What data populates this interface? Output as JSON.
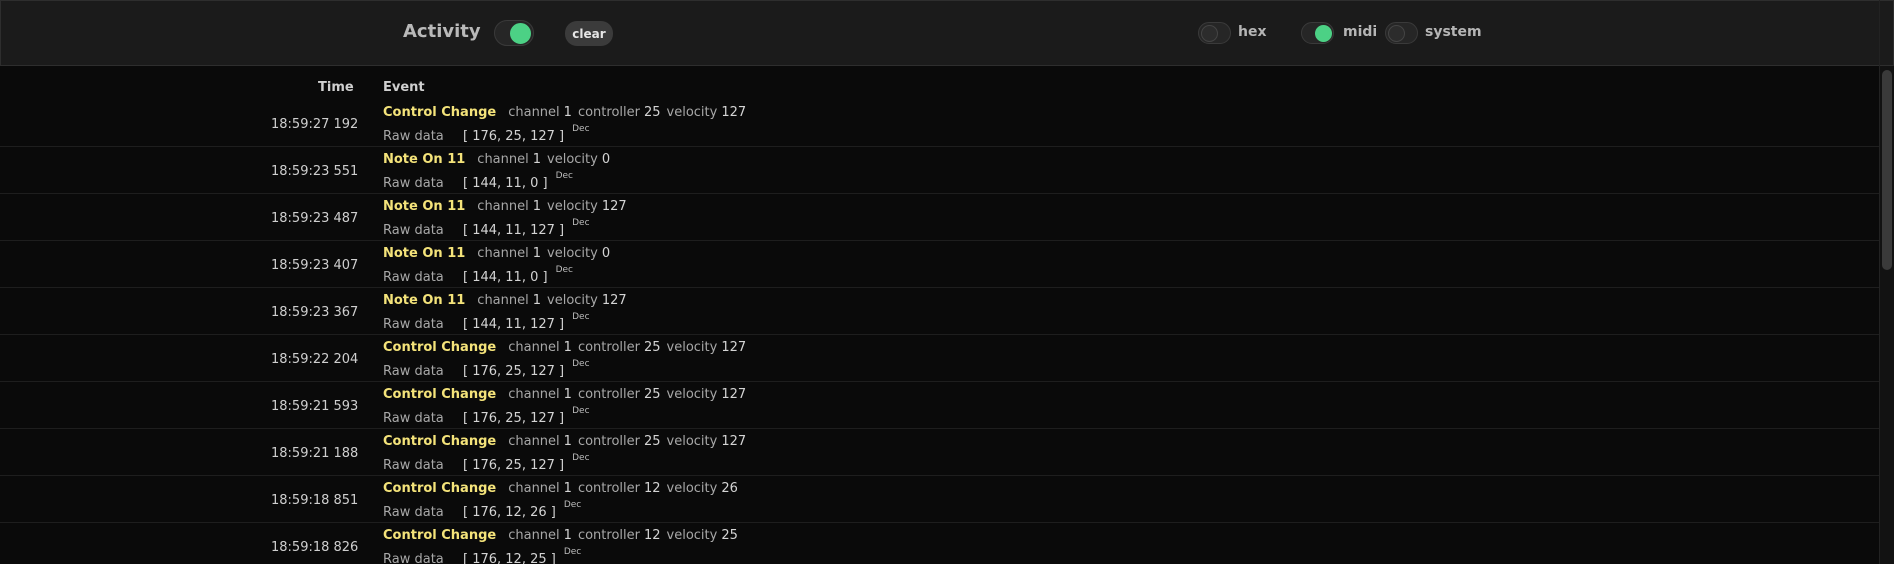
{
  "header": {
    "title": "Activity",
    "clear_label": "clear",
    "options": [
      {
        "label": "hex",
        "on": false
      },
      {
        "label": "midi",
        "on": true
      },
      {
        "label": "system",
        "on": false
      }
    ],
    "activity_on": true,
    "accent": "#4cd185"
  },
  "table": {
    "col_time": "Time",
    "col_event": "Event",
    "raw_label": "Raw data",
    "dec_label": "Dec",
    "event_color": "#f4e37a",
    "rows": [
      {
        "time": "18:59:27 192",
        "event": "Control Change",
        "attrs": [
          [
            "channel",
            "1"
          ],
          [
            "controller",
            "25"
          ],
          [
            "velocity",
            "127"
          ]
        ],
        "raw": "[ 176, 25, 127 ]"
      },
      {
        "time": "18:59:23 551",
        "event": "Note On 11",
        "attrs": [
          [
            "channel",
            "1"
          ],
          [
            "velocity",
            "0"
          ]
        ],
        "raw": "[ 144, 11, 0 ]"
      },
      {
        "time": "18:59:23 487",
        "event": "Note On 11",
        "attrs": [
          [
            "channel",
            "1"
          ],
          [
            "velocity",
            "127"
          ]
        ],
        "raw": "[ 144, 11, 127 ]"
      },
      {
        "time": "18:59:23 407",
        "event": "Note On 11",
        "attrs": [
          [
            "channel",
            "1"
          ],
          [
            "velocity",
            "0"
          ]
        ],
        "raw": "[ 144, 11, 0 ]"
      },
      {
        "time": "18:59:23 367",
        "event": "Note On 11",
        "attrs": [
          [
            "channel",
            "1"
          ],
          [
            "velocity",
            "127"
          ]
        ],
        "raw": "[ 144, 11, 127 ]"
      },
      {
        "time": "18:59:22 204",
        "event": "Control Change",
        "attrs": [
          [
            "channel",
            "1"
          ],
          [
            "controller",
            "25"
          ],
          [
            "velocity",
            "127"
          ]
        ],
        "raw": "[ 176, 25, 127 ]"
      },
      {
        "time": "18:59:21 593",
        "event": "Control Change",
        "attrs": [
          [
            "channel",
            "1"
          ],
          [
            "controller",
            "25"
          ],
          [
            "velocity",
            "127"
          ]
        ],
        "raw": "[ 176, 25, 127 ]"
      },
      {
        "time": "18:59:21 188",
        "event": "Control Change",
        "attrs": [
          [
            "channel",
            "1"
          ],
          [
            "controller",
            "25"
          ],
          [
            "velocity",
            "127"
          ]
        ],
        "raw": "[ 176, 25, 127 ]"
      },
      {
        "time": "18:59:18 851",
        "event": "Control Change",
        "attrs": [
          [
            "channel",
            "1"
          ],
          [
            "controller",
            "12"
          ],
          [
            "velocity",
            "26"
          ]
        ],
        "raw": "[ 176, 12, 26 ]"
      },
      {
        "time": "18:59:18 826",
        "event": "Control Change",
        "attrs": [
          [
            "channel",
            "1"
          ],
          [
            "controller",
            "12"
          ],
          [
            "velocity",
            "25"
          ]
        ],
        "raw": "[ 176, 12, 25 ]"
      }
    ]
  }
}
